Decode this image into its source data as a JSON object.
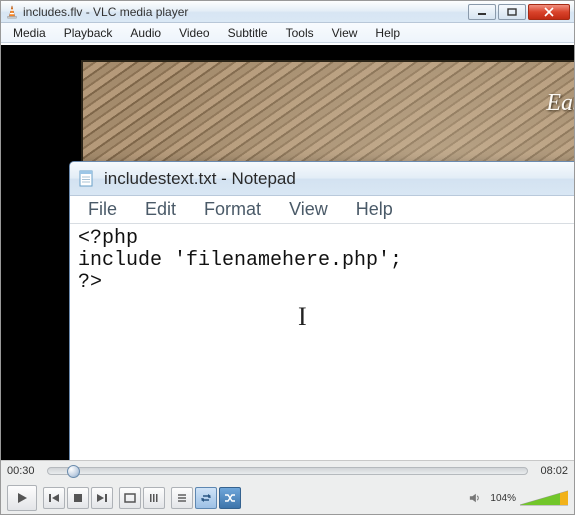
{
  "vlc": {
    "title": "includes.flv - VLC media player",
    "menus": [
      "Media",
      "Playback",
      "Audio",
      "Video",
      "Subtitle",
      "Tools",
      "View",
      "Help"
    ],
    "time_elapsed": "00:30",
    "time_total": "08:02",
    "volume_label": "104%",
    "banner_text": "Easy"
  },
  "notepad": {
    "title": "includestext.txt - Notepad",
    "menus": [
      "File",
      "Edit",
      "Format",
      "View",
      "Help"
    ],
    "content": "<?php\ninclude 'filenamehere.php';\n?>"
  }
}
